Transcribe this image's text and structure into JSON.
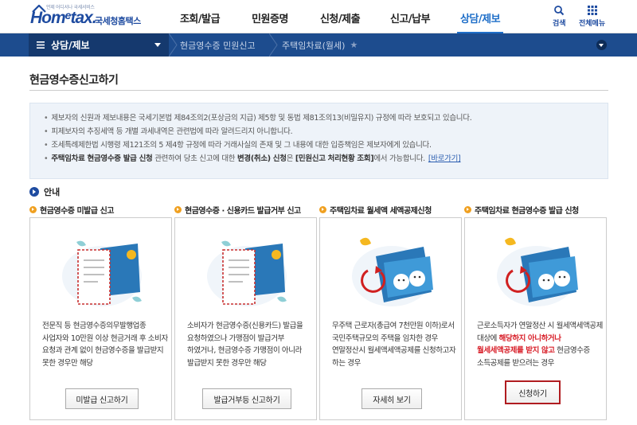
{
  "header": {
    "logo_tagline": "언제 어디서나 국세서비스",
    "logo_text": "Hom",
    "logo_e": "e",
    "logo_text2": "tax.",
    "logo_sub": "국세청홈택스",
    "nav": [
      "조회/발급",
      "민원증명",
      "신청/제출",
      "신고/납부",
      "상담/제보"
    ],
    "active_nav_index": 4,
    "search_label": "검색",
    "all_menu_label": "전체메뉴",
    "accent_color": "#1e4ba0"
  },
  "location": {
    "level1": "상담/제보",
    "level2": "현금영수증 민원신고",
    "level3": "주택임차료(월세)"
  },
  "page": {
    "title": "현금영수증신고하기"
  },
  "notice": {
    "items": [
      "제보자의 신원과 제보내용은 국세기본법 제84조의2(포상금의 지급) 제5항 및 동법 제81조의13(비밀유지) 규정에 따라 보호되고 있습니다.",
      "피제보자의 추징세액 등 개별 과세내역은 관련법에 따라 알려드리지 아니합니다.",
      "조세특례제한법 시행령 제121조의 5 제4항 규정에 따라 거래사실의 존재 및 그 내용에 대한 입증책임은 제보자에게 있습니다."
    ],
    "item4_bold1": "주택임차료 현금영수증 발급 신청",
    "item4_mid": " 관련하여 당초 신고에 대한 ",
    "item4_bold2": "변경(취소) 신청",
    "item4_mid2": "은 ",
    "item4_bold3": "[민원신고 처리현황 조회]",
    "item4_tail": "에서 가능합니다.",
    "item4_link": "[바로가기]"
  },
  "guide": {
    "label": "안내"
  },
  "cards": [
    {
      "title": "현금영수증 미발급 신고",
      "desc": "전문직 등 현금영수증의무발행업종 사업자와 10만원 이상 현금거래 후 소비자 요청과 관계 없이 현금영수증을 발급받지 못한 경우만 해당",
      "button": "미발급 신고하기"
    },
    {
      "title": "현금영수증 · 신용카드 발급거부 신고",
      "desc": "소비자가 현금영수증(신용카드) 발급을 요청하였으나 가맹점이 발급거부 하였거나, 현금영수증 가맹점이 아니라 발급받지 못한 경우만 해당",
      "button": "발급거부등 신고하기"
    },
    {
      "title": "주택임차료 월세액 세액공제신청",
      "desc": "무주택 근로자(총급여 7천만원 이하)로서 국민주택규모의 주택을 임차한 경우 연말정산시 월세액세액공제를 신청하고자 하는 경우",
      "button": "자세히 보기"
    },
    {
      "title": "주택임차료 현금영수증 발급 신청",
      "desc_pre": "근로소득자가 연말정산 시 월세액세액공제 대상에 ",
      "desc_hl": "해당하지 아니하거나 월세세액공제를 받지 않고",
      "desc_post": " 현금영수증 소득공제를 받으려는 경우",
      "button": "신청하기"
    }
  ]
}
